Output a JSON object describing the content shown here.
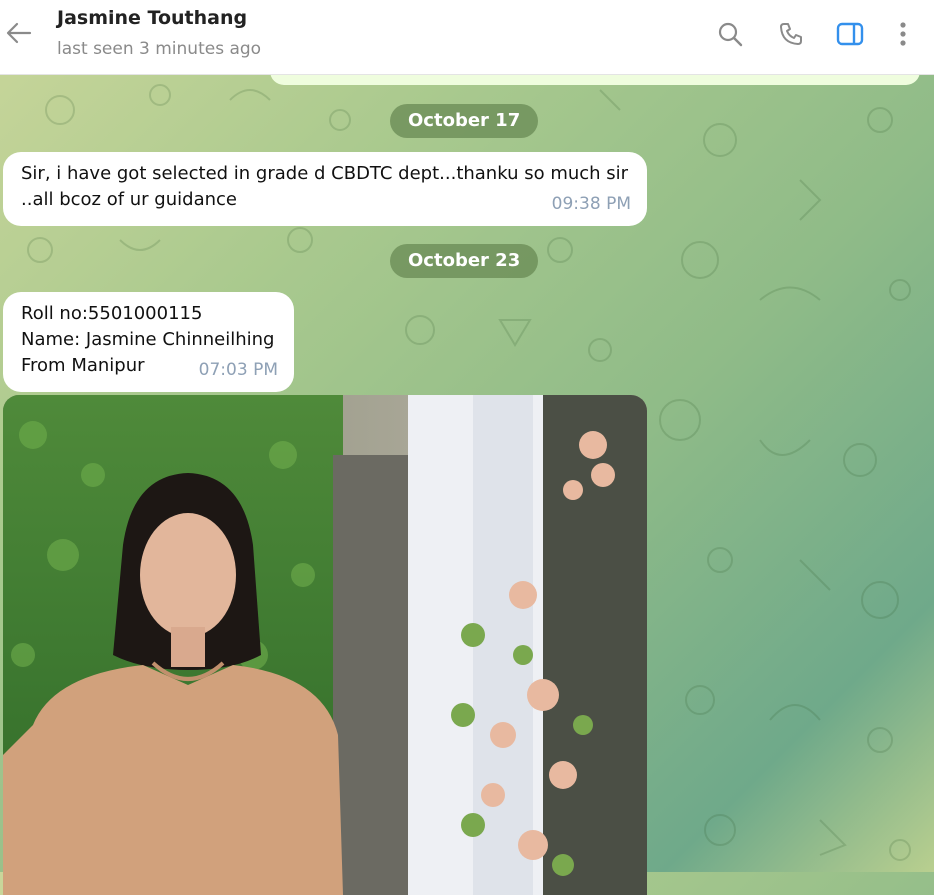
{
  "header": {
    "title": "Jasmine Touthang",
    "subtitle": "last seen 3 minutes ago"
  },
  "dates": [
    "October 17",
    "October 23"
  ],
  "messages": [
    {
      "lines": [
        "Sir, i have got selected in grade d CBDTC dept...thanku so much sir",
        "..all bcoz of ur guidance"
      ],
      "time": "09:38 PM"
    },
    {
      "lines": [
        "Roll no:5501000115",
        "Name: Jasmine Chinneilhing",
        "From Manipur"
      ],
      "time": "07:03 PM"
    }
  ],
  "icons": {
    "back": "arrow-left",
    "search": "magnifier",
    "call": "phone",
    "side_panel": "sidebar-toggle",
    "menu": "three-dots-vertical"
  },
  "colors": {
    "accent": "#3390ec",
    "date_pill": "#6a8c56",
    "bubble": "#ffffff",
    "time": "#8ea0b5"
  }
}
